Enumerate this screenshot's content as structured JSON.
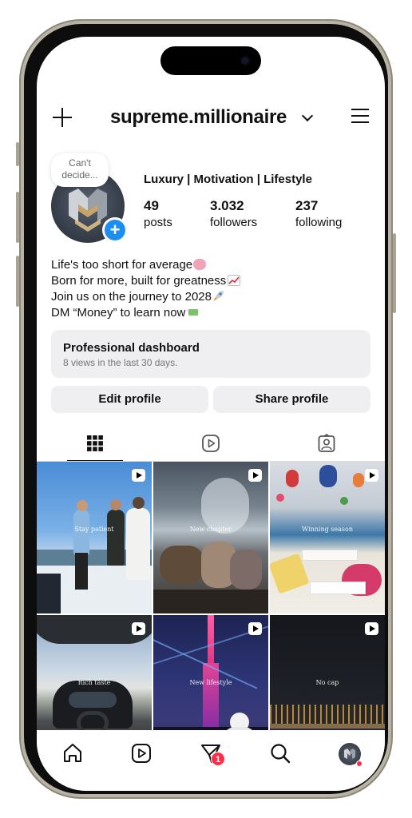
{
  "header": {
    "username": "supreme.millionaire"
  },
  "profile": {
    "note": "Can't decide...",
    "category_line": "Luxury | Motivation | Lifestyle",
    "stats": [
      {
        "value": "49",
        "label": "posts"
      },
      {
        "value": "3.032",
        "label": "followers"
      },
      {
        "value": "237",
        "label": "following"
      }
    ],
    "bio_lines": [
      "Life's too short for average",
      "Born for more, built for greatness",
      "Join us on the journey to 2028",
      "DM “Money” to learn now"
    ]
  },
  "dashboard": {
    "title": "Professional dashboard",
    "subtitle": "8 views in the last 30 days."
  },
  "buttons": {
    "edit": "Edit profile",
    "share": "Share profile"
  },
  "tabs": [
    {
      "icon": "grid-icon",
      "active": true
    },
    {
      "icon": "reels-icon",
      "active": false
    },
    {
      "icon": "tagged-icon",
      "active": false
    }
  ],
  "posts": [
    {
      "caption": "Stay patient",
      "icon": "reel-icon"
    },
    {
      "caption": "New chapter",
      "icon": "reel-icon"
    },
    {
      "caption": "Winning season",
      "icon": "reel-icon"
    },
    {
      "caption": "Rich taste",
      "icon": "reel-icon"
    },
    {
      "caption": "New lifestyle",
      "icon": "reel-icon"
    },
    {
      "caption": "No cap",
      "icon": "reel-icon"
    }
  ],
  "bottom_nav": {
    "items": [
      "home-icon",
      "reels-icon",
      "messages-icon",
      "search-icon",
      "profile-avatar"
    ],
    "messages_badge": "1"
  },
  "colors": {
    "accent_blue": "#1d8ef0",
    "badge_red": "#ff2d47",
    "button_bg": "#efeff1"
  }
}
